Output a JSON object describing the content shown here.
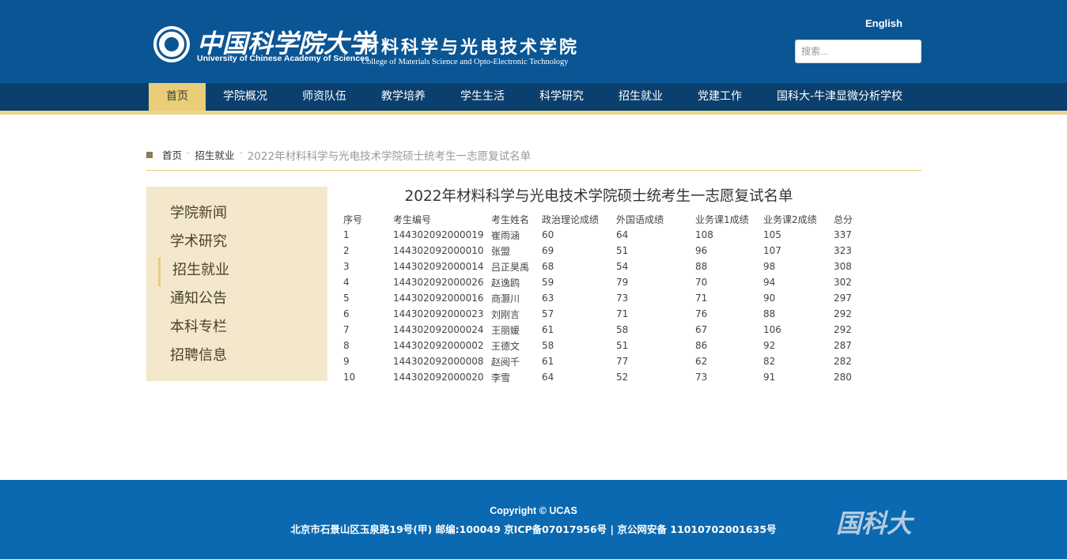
{
  "header": {
    "logo_cn": "中国科学院大学",
    "logo_en": "University of Chinese Academy of Sciences",
    "college_cn": "材料科学与光电技术学院",
    "college_en": "College of Materials Science and Opto-Electronic Technology",
    "lang_link": "English",
    "search_placeholder": "搜索..."
  },
  "nav": {
    "items": [
      "首页",
      "学院概况",
      "师资队伍",
      "教学培养",
      "学生生活",
      "科学研究",
      "招生就业",
      "党建工作",
      "国科大-牛津显微分析学校"
    ],
    "active_index": 0
  },
  "breadcrumb": {
    "home": "首页",
    "section": "招生就业",
    "current": "2022年材料科学与光电技术学院硕士统考生一志愿复试名单"
  },
  "sidebar": {
    "items": [
      "学院新闻",
      "学术研究",
      "招生就业",
      "通知公告",
      "本科专栏",
      "招聘信息"
    ],
    "active_index": 2
  },
  "main": {
    "title": "2022年材料科学与光电技术学院硕士统考生一志愿复试名单",
    "table": {
      "headers": [
        "序号",
        "考生编号",
        "考生姓名",
        "政治理论成绩",
        "外国语成绩",
        "业务课1成绩",
        "业务课2成绩",
        "总分"
      ],
      "rows": [
        [
          "1",
          "144302092000019",
          "崔雨涵",
          "60",
          "64",
          "108",
          "105",
          "337"
        ],
        [
          "2",
          "144302092000010",
          "张盟",
          "69",
          "51",
          "96",
          "107",
          "323"
        ],
        [
          "3",
          "144302092000014",
          "吕正昊禹",
          "68",
          "54",
          "88",
          "98",
          "308"
        ],
        [
          "4",
          "144302092000026",
          "赵逸鸥",
          "59",
          "79",
          "70",
          "94",
          "302"
        ],
        [
          "5",
          "144302092000016",
          "商灏川",
          "63",
          "73",
          "71",
          "90",
          "297"
        ],
        [
          "6",
          "144302092000023",
          "刘刚言",
          "57",
          "71",
          "76",
          "88",
          "292"
        ],
        [
          "7",
          "144302092000024",
          "王丽媛",
          "61",
          "58",
          "67",
          "106",
          "292"
        ],
        [
          "8",
          "144302092000002",
          "王德文",
          "58",
          "51",
          "86",
          "92",
          "287"
        ],
        [
          "9",
          "144302092000008",
          "赵阅千",
          "61",
          "77",
          "62",
          "82",
          "282"
        ],
        [
          "10",
          "144302092000020",
          "李雪",
          "64",
          "52",
          "73",
          "91",
          "280"
        ]
      ]
    }
  },
  "footer": {
    "copyright": "Copyright © UCAS",
    "address": "北京市石景山区玉泉路19号(甲) 邮编:100049 京ICP备07017956号 | 京公网安备 11010702001635号",
    "logo_text": "国科大"
  },
  "colors": {
    "header_blue": "#0a5594",
    "nav_dark": "#0b3f6d",
    "accent_gold": "#e9cd77",
    "sidebar_bg": "#f3e8cb",
    "footer_blue": "#0a69b1"
  }
}
